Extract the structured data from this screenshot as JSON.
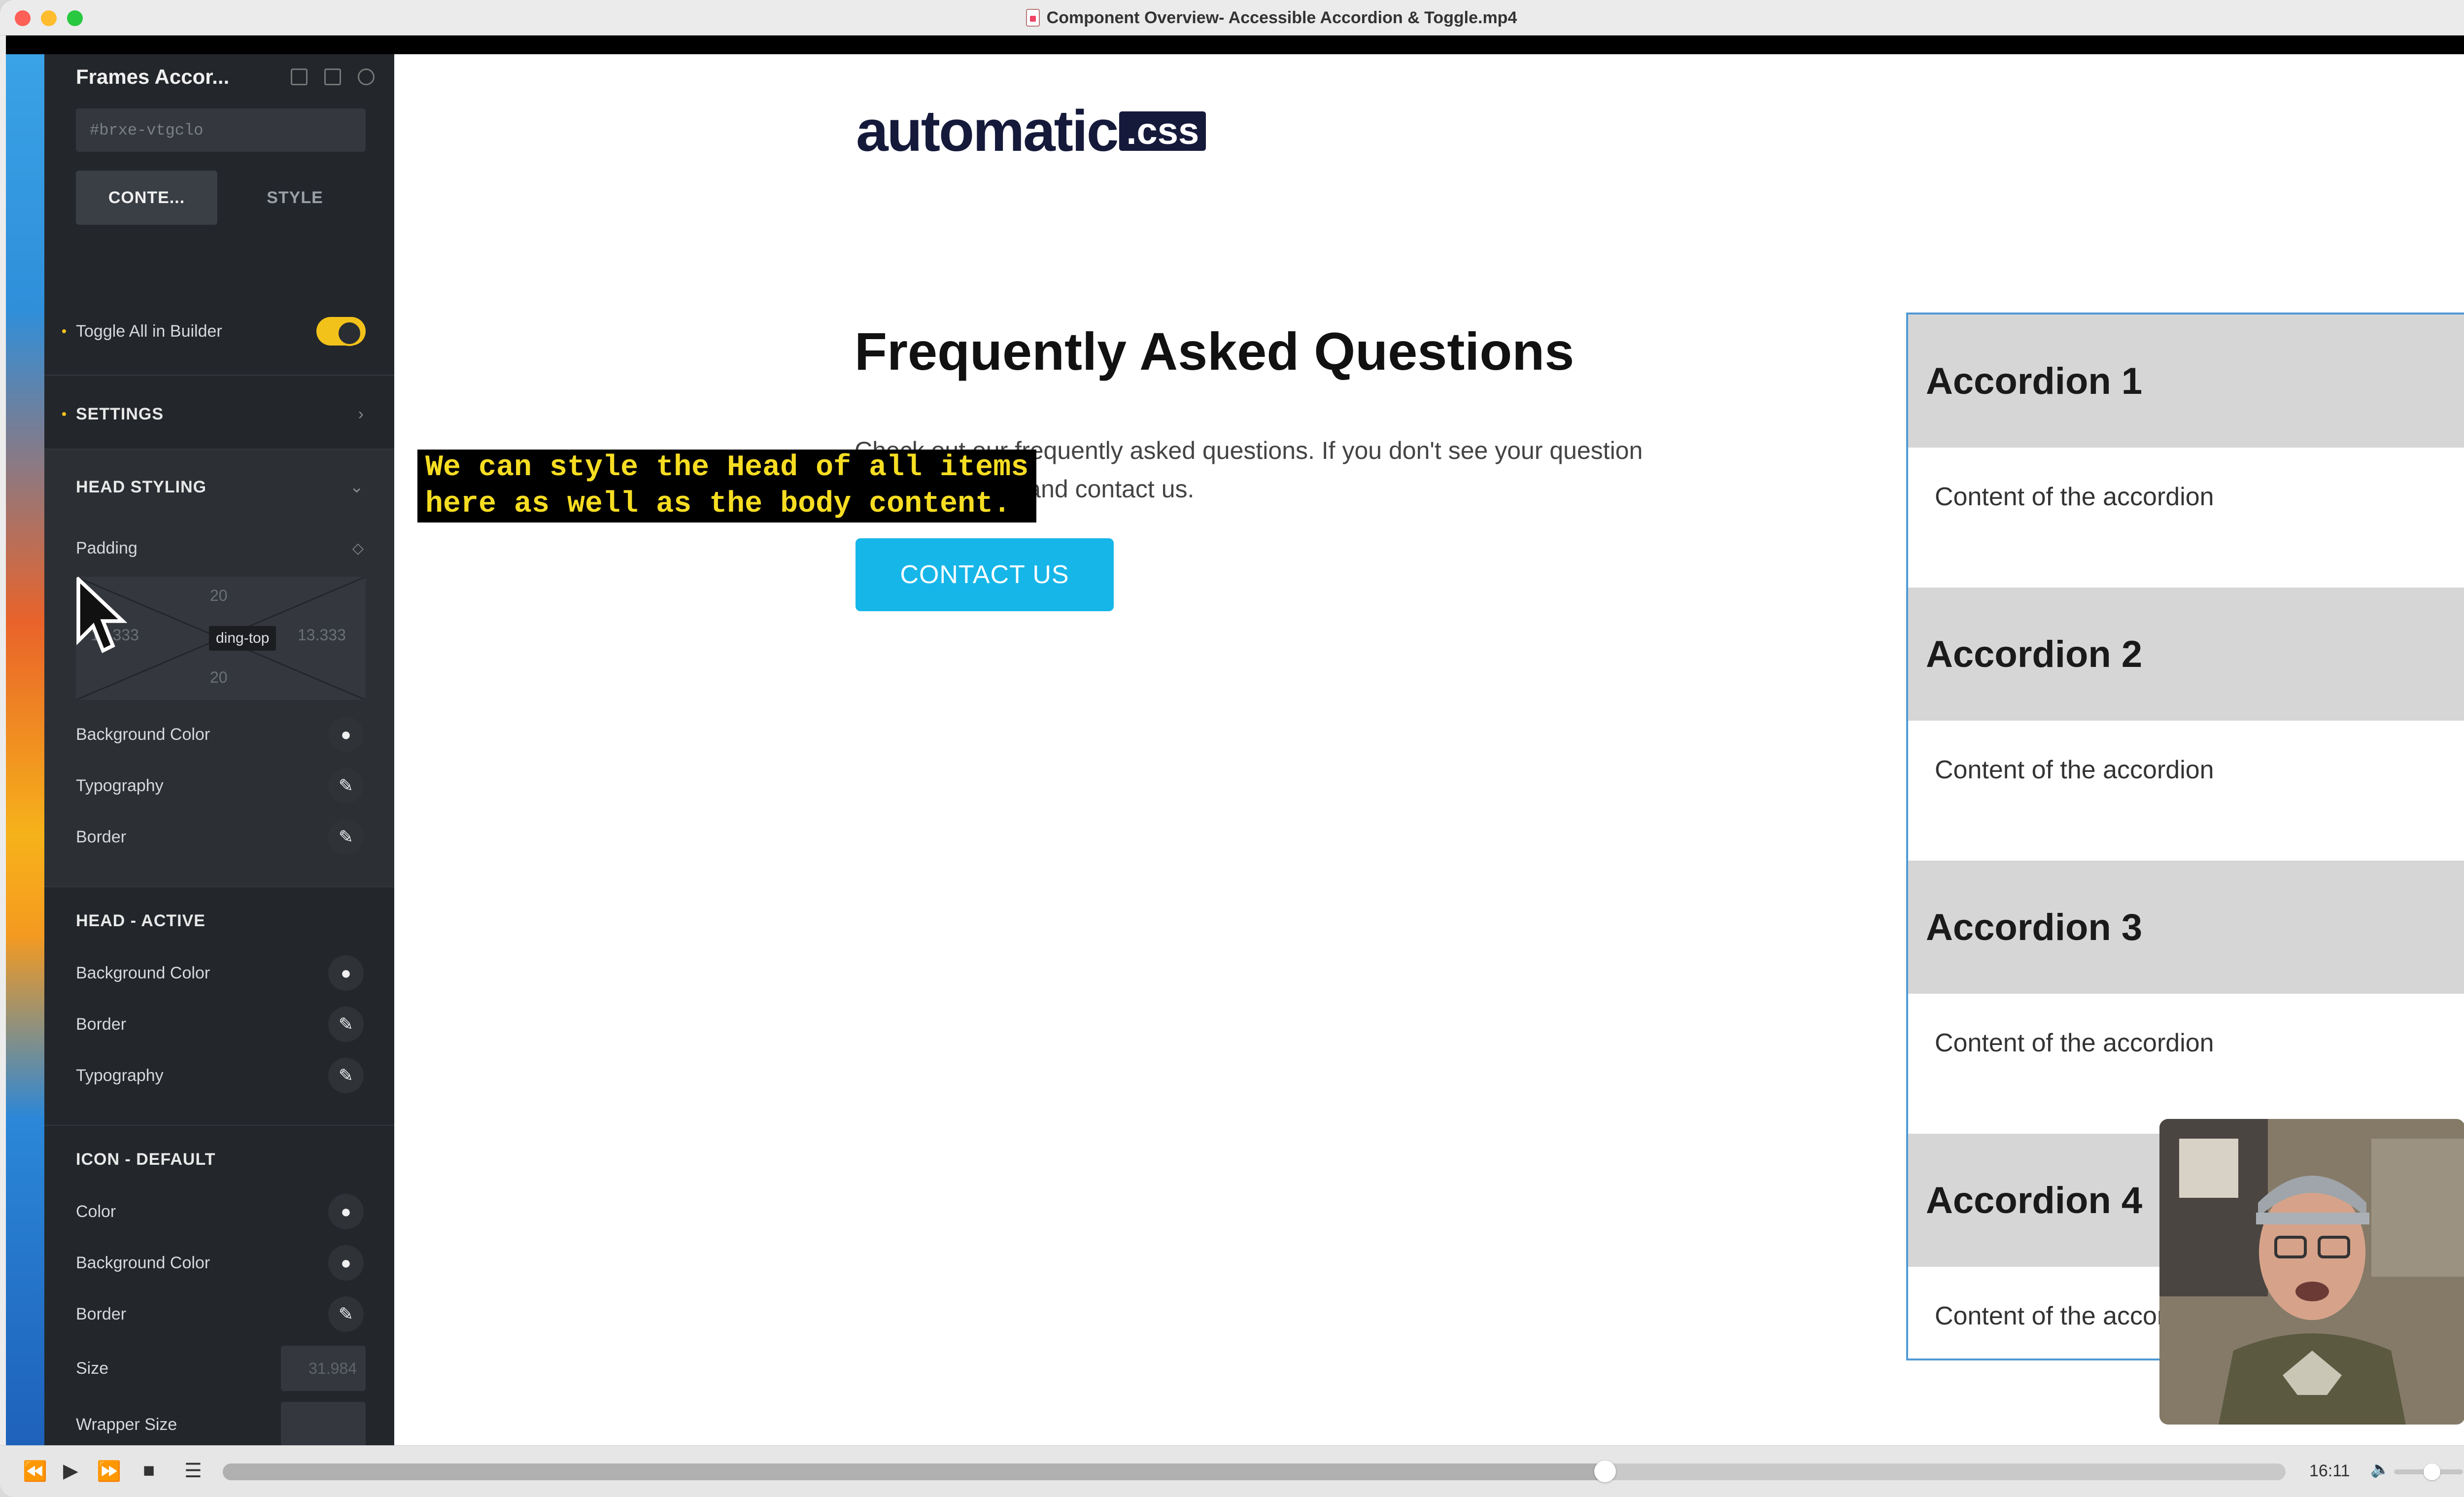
{
  "window": {
    "title": "Component Overview- Accessible Accordion & Toggle.mp4"
  },
  "builder": {
    "element_title": "Frames Accor...",
    "element_id": "#brxe-vtgclo",
    "tabs": [
      "CONTE...",
      "STYLE"
    ],
    "toggle_all_label": "Toggle All in Builder",
    "settings_label": "SETTINGS",
    "head_styling": {
      "label": "HEAD STYLING",
      "padding_label": "Padding",
      "padding": {
        "top": "20",
        "left": "13.333",
        "right": "13.333",
        "bottom": "20"
      },
      "padding_tooltip": "ding-top",
      "rows": [
        "Background Color",
        "Typography",
        "Border"
      ]
    },
    "head_active": {
      "label": "HEAD - ACTIVE",
      "rows": [
        "Background Color",
        "Border",
        "Typography"
      ]
    },
    "icon_default": {
      "label": "ICON - DEFAULT",
      "rows": [
        "Color",
        "Background Color",
        "Border"
      ],
      "size_label": "Size",
      "size_placeholder": "31.984",
      "wrapper_size_label": "Wrapper Size"
    }
  },
  "canvas": {
    "logo_text": "automatic",
    "logo_badge": ".css",
    "faq_title": "Frequently Asked Questions",
    "faq_text": "Check out our frequently asked questions. If you don't see your question here, go ahead and contact us.",
    "contact_button": "CONTACT US",
    "accordions": [
      {
        "title": "Accordion 1",
        "content": "Content of the accordion"
      },
      {
        "title": "Accordion 2",
        "content": "Content of the accordion"
      },
      {
        "title": "Accordion 3",
        "content": "Content of the accordion"
      },
      {
        "title": "Accordion 4",
        "content": "Content of the accordion"
      }
    ]
  },
  "subtitle": {
    "line1": "We can style the Head of all items",
    "line2": "here as well as the body content."
  },
  "player": {
    "time": "16:11",
    "progress": 0.67,
    "volume": 0.55
  }
}
